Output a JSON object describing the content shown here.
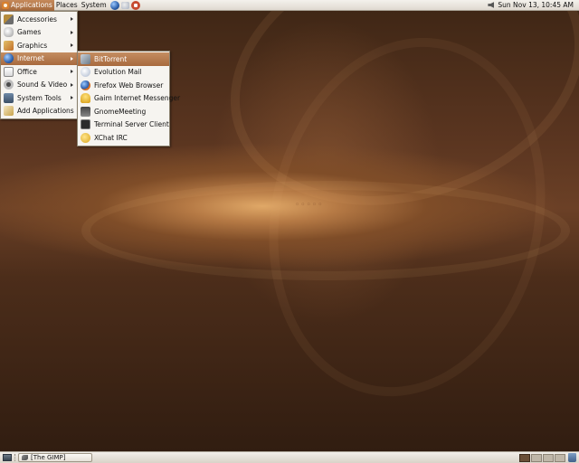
{
  "top_panel": {
    "menus": [
      {
        "label": "Applications",
        "active": true
      },
      {
        "label": "Places"
      },
      {
        "label": "System"
      }
    ],
    "launchers": [
      "web-browser-icon",
      "mail-client-icon",
      "help-icon"
    ],
    "clock": "Sun Nov 13, 10:45 AM",
    "tray_icons": [
      "volume-icon"
    ]
  },
  "applications_menu": {
    "items": [
      {
        "label": "Accessories",
        "icon": "accessories-icon",
        "submenu": true
      },
      {
        "label": "Games",
        "icon": "games-icon",
        "submenu": true
      },
      {
        "label": "Graphics",
        "icon": "graphics-icon",
        "submenu": true
      },
      {
        "label": "Internet",
        "icon": "internet-icon",
        "submenu": true,
        "highlighted": true
      },
      {
        "label": "Office",
        "icon": "office-icon",
        "submenu": true
      },
      {
        "label": "Sound & Video",
        "icon": "sound-video-icon",
        "submenu": true
      },
      {
        "label": "System Tools",
        "icon": "system-tools-icon",
        "submenu": true
      },
      {
        "label": "Add Applications",
        "icon": "add-applications-icon",
        "submenu": false
      }
    ]
  },
  "internet_submenu": {
    "items": [
      {
        "label": "BitTorrent",
        "icon": "bittorrent-icon",
        "highlighted": true
      },
      {
        "label": "Evolution Mail",
        "icon": "evolution-mail-icon"
      },
      {
        "label": "Firefox Web Browser",
        "icon": "firefox-icon"
      },
      {
        "label": "Gaim Internet Messenger",
        "icon": "gaim-icon"
      },
      {
        "label": "GnomeMeeting",
        "icon": "gnomemeeting-icon"
      },
      {
        "label": "Terminal Server Client",
        "icon": "terminal-icon"
      },
      {
        "label": "XChat IRC",
        "icon": "xchat-icon"
      }
    ]
  },
  "bottom_panel": {
    "show_desktop_icon": "show-desktop-icon",
    "tasks": [
      {
        "label": "[The GIMP]",
        "icon": "gimp-icon"
      }
    ],
    "workspaces": [
      {
        "active": true
      },
      {
        "active": false
      },
      {
        "active": false
      },
      {
        "active": false
      }
    ],
    "trash_icon": "trash-icon"
  },
  "colors": {
    "highlight": "#b07448",
    "wallpaper_dark": "#3e2615",
    "wallpaper_glow": "#e0a867",
    "panel": "#e8e4dd"
  }
}
